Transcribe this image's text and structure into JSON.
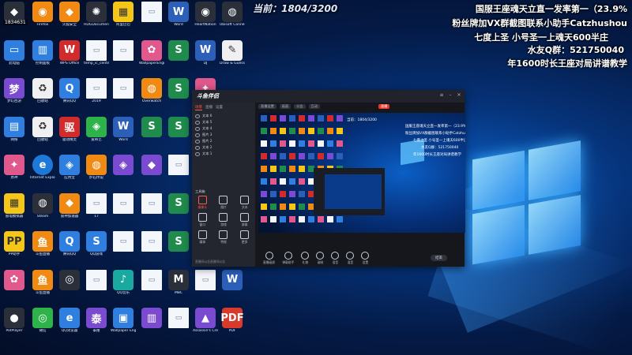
{
  "overlay": {
    "counter": "当前：1804/3200",
    "lines": [
      "国服王座魂天立直一发率第一（23.9%",
      "粉丝牌加VX群截图联系小助手Catzhushou",
      "七度上圣  小号圣一上魂天600半庄",
      "水友Q群：521750040",
      "年1600时长王座对局讲谱教学"
    ],
    "corner_id": "1834631"
  },
  "desktop": {
    "columns": [
      [
        {
          "label": "",
          "icon": "app-icon",
          "glyph": "◆"
        },
        {
          "label": "此电脑",
          "icon": "computer-icon",
          "glyph": "▭"
        },
        {
          "label": "梦幻西游",
          "icon": "game-icon",
          "glyph": "梦"
        },
        {
          "label": "网络",
          "icon": "network-icon",
          "glyph": "▤"
        },
        {
          "label": "原神",
          "icon": "character-icon",
          "glyph": "✦"
        },
        {
          "label": "雷电模拟器",
          "icon": "emulator-icon",
          "glyph": "▦"
        },
        {
          "label": "PP助手",
          "icon": "pp-icon",
          "glyph": "PP"
        },
        {
          "label": "",
          "icon": "anime-icon",
          "glyph": "✿"
        },
        {
          "label": "PotPlayer",
          "icon": "player-icon",
          "glyph": "●"
        }
      ],
      [
        {
          "label": "Firefox",
          "icon": "firefox-icon",
          "glyph": "◉"
        },
        {
          "label": "控制面板",
          "icon": "control-panel-icon",
          "glyph": "▥"
        },
        {
          "label": "回收站",
          "icon": "recycle-bin-icon",
          "glyph": "♻"
        },
        {
          "label": "回收站",
          "icon": "recycle-bin-icon",
          "glyph": "♻"
        },
        {
          "label": "Internet Explorer",
          "icon": "ie-icon",
          "glyph": "e"
        },
        {
          "label": "Steam",
          "icon": "steam-icon",
          "glyph": "◍"
        },
        {
          "label": "斗鱼直播",
          "icon": "douyu-icon",
          "glyph": "鱼"
        },
        {
          "label": "斗鱼直播",
          "icon": "douyu-icon",
          "glyph": "鱼"
        },
        {
          "label": "微信",
          "icon": "wechat-icon",
          "glyph": "◎"
        }
      ],
      [
        {
          "label": "火狐安全",
          "icon": "shield-icon",
          "glyph": "◆"
        },
        {
          "label": "WPS Office",
          "icon": "wps-icon",
          "glyph": "W"
        },
        {
          "label": "腾讯QQ",
          "icon": "qq-icon",
          "glyph": "Q"
        },
        {
          "label": "驱动精灵",
          "icon": "driver-icon",
          "glyph": "驱"
        },
        {
          "label": "应用宝",
          "icon": "appstore-icon",
          "glyph": "◈"
        },
        {
          "label": "雷神加速器",
          "icon": "shield-icon",
          "glyph": "◆"
        },
        {
          "label": "腾讯QQ",
          "icon": "qq-icon",
          "glyph": "Q"
        },
        {
          "label": "",
          "icon": "target-icon",
          "glyph": "◎"
        },
        {
          "label": "QQ浏览器",
          "icon": "browser-icon",
          "glyph": "e"
        }
      ],
      [
        {
          "label": "HDGDocumentor",
          "icon": "gear-icon",
          "glyph": "✺"
        },
        {
          "label": "temp_ic_center",
          "icon": "file-icon",
          "glyph": "▭"
        },
        {
          "label": "2019",
          "icon": "file-icon",
          "glyph": "▭"
        },
        {
          "label": "爱奇艺",
          "icon": "media-icon",
          "glyph": "◈"
        },
        {
          "label": "炉石传说",
          "icon": "hearthstone-icon",
          "glyph": "◍"
        },
        {
          "label": "17",
          "icon": "file-icon",
          "glyph": "▭"
        },
        {
          "label": "QQ游戏",
          "icon": "qq-game-icon",
          "glyph": "S"
        },
        {
          "label": "",
          "icon": "file-icon",
          "glyph": "▭"
        },
        {
          "label": "泰隆",
          "icon": "game-icon",
          "glyph": "泰"
        }
      ],
      [
        {
          "label": "阿里巴巴",
          "icon": "folder-icon",
          "glyph": "▦"
        },
        {
          "label": "",
          "icon": "document-icon",
          "glyph": "▭"
        },
        {
          "label": "",
          "icon": "document-icon",
          "glyph": "▭"
        },
        {
          "label": "Word",
          "icon": "word-icon",
          "glyph": "W"
        },
        {
          "label": "",
          "icon": "game-icon",
          "glyph": "◈"
        },
        {
          "label": "",
          "icon": "file-icon",
          "glyph": "▭"
        },
        {
          "label": "",
          "icon": "file-icon",
          "glyph": "▭"
        },
        {
          "label": "QQ音乐",
          "icon": "music-icon",
          "glyph": "♪"
        },
        {
          "label": "Wallpaper Engine",
          "icon": "wallpaper-icon",
          "glyph": "▣"
        }
      ],
      [
        {
          "label": "",
          "icon": "file-icon",
          "glyph": "▭"
        },
        {
          "label": "WallpaperEngine",
          "icon": "anime-icon",
          "glyph": "✿"
        },
        {
          "label": "Overwatch",
          "icon": "overwatch-icon",
          "glyph": "◍"
        },
        {
          "label": "",
          "icon": "sheet-icon",
          "glyph": "S"
        },
        {
          "label": "",
          "icon": "game-icon",
          "glyph": "◆"
        },
        {
          "label": "",
          "icon": "document-icon",
          "glyph": "▭"
        },
        {
          "label": "",
          "icon": "file-icon",
          "glyph": "▭"
        },
        {
          "label": "",
          "icon": "file-icon",
          "glyph": "▭"
        },
        {
          "label": "",
          "icon": "book-icon",
          "glyph": "▥"
        }
      ],
      [
        {
          "label": "Word",
          "icon": "word-icon",
          "glyph": "W"
        },
        {
          "label": "",
          "icon": "sheet-icon",
          "glyph": "S"
        },
        {
          "label": "",
          "icon": "sheet-icon",
          "glyph": "S"
        },
        {
          "label": "",
          "icon": "sheet-icon",
          "glyph": "S"
        },
        {
          "label": "",
          "icon": "document-icon",
          "glyph": "▭"
        },
        {
          "label": "",
          "icon": "sheet-icon",
          "glyph": "S"
        },
        {
          "label": "",
          "icon": "sheet-icon",
          "glyph": "S"
        },
        {
          "label": "MBC",
          "icon": "app-icon",
          "glyph": "M"
        },
        {
          "label": "",
          "icon": "document-icon",
          "glyph": "▭"
        }
      ],
      [
        {
          "label": "HeartNation",
          "icon": "gear-icon",
          "glyph": "◉"
        },
        {
          "label": "DJ",
          "icon": "word-icon",
          "glyph": "W"
        },
        {
          "label": "",
          "icon": "character-icon",
          "glyph": "✦"
        },
        {
          "label": "",
          "icon": "document-icon",
          "glyph": "▭"
        },
        {
          "label": "",
          "icon": "sheet-icon",
          "glyph": "S"
        },
        {
          "label": "",
          "icon": "sheet-icon",
          "glyph": "S"
        },
        {
          "label": "",
          "icon": "document-icon",
          "glyph": "▭"
        },
        {
          "label": "",
          "icon": "document-icon",
          "glyph": "▭"
        },
        {
          "label": "Assassin's Creed Odyssey",
          "icon": "game-icon",
          "glyph": "▲"
        }
      ],
      [
        {
          "label": "Ubisoft Connect",
          "icon": "ubisoft-icon",
          "glyph": "◍"
        },
        {
          "label": "Draw & Guess",
          "icon": "drawing-icon",
          "glyph": "✎"
        },
        {
          "label": "",
          "icon": "",
          "glyph": ""
        },
        {
          "label": "",
          "icon": "",
          "glyph": ""
        },
        {
          "label": "",
          "icon": "",
          "glyph": ""
        },
        {
          "label": "",
          "icon": "",
          "glyph": ""
        },
        {
          "label": "",
          "icon": "",
          "glyph": ""
        },
        {
          "label": "",
          "icon": "word-icon",
          "glyph": "W"
        },
        {
          "label": "PDF",
          "icon": "pdf-icon",
          "glyph": "PDF"
        }
      ]
    ]
  },
  "app": {
    "logo": "斗鱼伴侣",
    "version": "",
    "side_tabs": [
      "场景",
      "直播",
      "设置"
    ],
    "sources": [
      "文本 6",
      "文本 5",
      "文本 4",
      "图片 3",
      "图片 2",
      "文本 2",
      "文本 1"
    ],
    "section_label": "工具箱",
    "tools": [
      {
        "label": "摄像头",
        "hot": true
      },
      {
        "label": "图片",
        "hot": false
      },
      {
        "label": "文本",
        "hot": false
      },
      {
        "label": "窗口",
        "hot": false
      },
      {
        "label": "游戏",
        "hot": false
      },
      {
        "label": "屏幕",
        "hot": false
      },
      {
        "label": "媒体",
        "hot": false
      },
      {
        "label": "特效",
        "hot": false
      },
      {
        "label": "更多",
        "hot": false
      }
    ],
    "side_footer": "直播间公告直播间公告",
    "main_tabs": [
      "直播设置",
      "画面",
      "公告",
      "互动"
    ],
    "live_badge": "直播",
    "bottom_tools": [
      "直播画质",
      "弹幕助手",
      "礼物",
      "录制",
      "语音",
      "混音",
      "设置"
    ],
    "start_label": "结束"
  }
}
